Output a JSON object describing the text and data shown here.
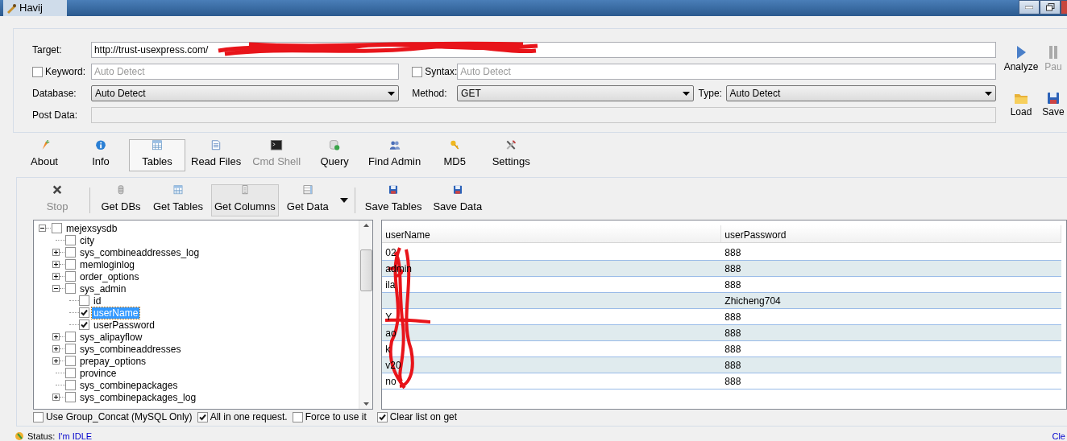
{
  "window": {
    "title": "Havij"
  },
  "form": {
    "target": {
      "label": "Target:",
      "value": "http://trust-usexpress.com/"
    },
    "keyword": {
      "label": "Keyword:",
      "checked": false,
      "placeholder": "Auto Detect"
    },
    "syntax": {
      "label": "Syntax:",
      "checked": false,
      "placeholder": "Auto Detect"
    },
    "database": {
      "label": "Database:",
      "value": "Auto Detect"
    },
    "method": {
      "label": "Method:",
      "value": "GET"
    },
    "type": {
      "label": "Type:",
      "value": "Auto Detect"
    },
    "post_data": {
      "label": "Post Data:",
      "disabled": true
    }
  },
  "side_buttons": [
    {
      "label": "Analyze",
      "disabled": false
    },
    {
      "label": "Pau",
      "disabled": true
    },
    {
      "label": "Load",
      "disabled": false
    },
    {
      "label": "Save",
      "disabled": false
    }
  ],
  "tabs": [
    {
      "label": "About",
      "selected": false,
      "disabled": false
    },
    {
      "label": "Info",
      "selected": false,
      "disabled": false
    },
    {
      "label": "Tables",
      "selected": true,
      "disabled": false
    },
    {
      "label": "Read Files",
      "selected": false,
      "disabled": false
    },
    {
      "label": "Cmd Shell",
      "selected": false,
      "disabled": true
    },
    {
      "label": "Query",
      "selected": false,
      "disabled": false
    },
    {
      "label": "Find Admin",
      "selected": false,
      "disabled": false
    },
    {
      "label": "MD5",
      "selected": false,
      "disabled": false
    },
    {
      "label": "Settings",
      "selected": false,
      "disabled": false
    }
  ],
  "toolbar": [
    {
      "kind": "button",
      "label": "Stop",
      "disabled": true,
      "pressed": false
    },
    {
      "kind": "separator"
    },
    {
      "kind": "button",
      "label": "Get DBs",
      "disabled": false,
      "pressed": false
    },
    {
      "kind": "button",
      "label": "Get Tables",
      "disabled": false,
      "pressed": false
    },
    {
      "kind": "button",
      "label": "Get Columns",
      "disabled": false,
      "pressed": true
    },
    {
      "kind": "button",
      "label": "Get Data",
      "disabled": false,
      "pressed": false
    },
    {
      "kind": "dropdown"
    },
    {
      "kind": "separator"
    },
    {
      "kind": "button",
      "label": "Save Tables",
      "disabled": false,
      "pressed": false
    },
    {
      "kind": "button",
      "label": "Save Data",
      "disabled": false,
      "pressed": false
    }
  ],
  "tree": [
    {
      "label": "mejexsysdb",
      "checked": false,
      "selected": false,
      "expanded": true,
      "children": [
        {
          "label": "city",
          "checked": false,
          "selected": false
        },
        {
          "label": "sys_combineaddresses_log",
          "checked": false,
          "selected": false,
          "expanded": false
        },
        {
          "label": "memloginlog",
          "checked": false,
          "selected": false,
          "expanded": false
        },
        {
          "label": "order_options",
          "checked": false,
          "selected": false,
          "expanded": false
        },
        {
          "label": "sys_admin",
          "checked": false,
          "selected": false,
          "expanded": true,
          "children": [
            {
              "label": "id",
              "checked": false,
              "selected": false
            },
            {
              "label": "userName",
              "checked": true,
              "selected": true
            },
            {
              "label": "userPassword",
              "checked": true,
              "selected": false
            }
          ]
        },
        {
          "label": "sys_alipayflow",
          "checked": false,
          "selected": false,
          "expanded": false
        },
        {
          "label": "sys_combineaddresses",
          "checked": false,
          "selected": false,
          "expanded": false
        },
        {
          "label": "prepay_options",
          "checked": false,
          "selected": false,
          "expanded": false
        },
        {
          "label": "province",
          "checked": false,
          "selected": false
        },
        {
          "label": "sys_combinepackages",
          "checked": false,
          "selected": false
        },
        {
          "label": "sys_combinepackages_log",
          "checked": false,
          "selected": false,
          "expanded": false
        }
      ]
    }
  ],
  "grid": {
    "columns": [
      "userName",
      "userPassword"
    ],
    "rows": [
      {
        "cells": [
          "02",
          "888"
        ]
      },
      {
        "cells": [
          "admin",
          "888"
        ]
      },
      {
        "cells": [
          "ila",
          "888"
        ]
      },
      {
        "cells": [
          "",
          "Zhicheng704"
        ]
      },
      {
        "cells": [
          "Y",
          "888"
        ]
      },
      {
        "cells": [
          "ao",
          "888"
        ]
      },
      {
        "cells": [
          "k",
          "888"
        ]
      },
      {
        "cells": [
          "v20",
          "888"
        ]
      },
      {
        "cells": [
          "no",
          "888"
        ]
      }
    ]
  },
  "options": [
    {
      "label": "Use Group_Concat (MySQL Only)",
      "checked": false
    },
    {
      "label": "All in one request.",
      "checked": true
    },
    {
      "label": "Force to use it",
      "checked": false
    },
    {
      "label": "Clear list on get",
      "checked": true
    }
  ],
  "status": {
    "label": "Status:",
    "value": "I'm IDLE",
    "link": "Cle"
  }
}
